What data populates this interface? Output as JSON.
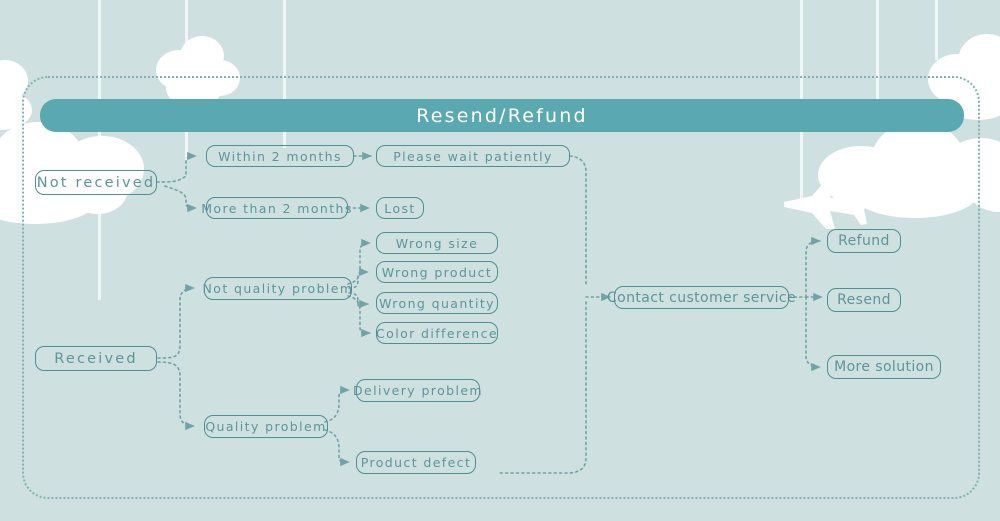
{
  "header": {
    "title": "Resend/Refund"
  },
  "colors": {
    "background": "#cfe0e0",
    "banner": "#5aa8b0",
    "node_border": "#4f8f92",
    "node_text": "#5c9599",
    "connector": "#6fa3a6",
    "frame": "#7fb3b3",
    "cloud": "#ffffff",
    "banner_text": "#ffffff"
  },
  "flow": {
    "roots": [
      {
        "id": "not-received",
        "label": "Not received"
      },
      {
        "id": "received",
        "label": "Received"
      }
    ],
    "not_received_branches": [
      {
        "id": "within-2-months",
        "label": "Within 2 months"
      },
      {
        "id": "more-than-2-months",
        "label": "More than 2 months"
      }
    ],
    "not_received_outcomes": [
      {
        "id": "please-wait-patiently",
        "label": "Please wait patiently"
      },
      {
        "id": "lost",
        "label": "Lost"
      }
    ],
    "received_branches": [
      {
        "id": "not-quality-problem",
        "label": "Not quality problem"
      },
      {
        "id": "quality-problem",
        "label": "Quality problem"
      }
    ],
    "not_quality_reasons": [
      {
        "id": "wrong-size",
        "label": "Wrong size"
      },
      {
        "id": "wrong-product",
        "label": "Wrong product"
      },
      {
        "id": "wrong-quantity",
        "label": "Wrong quantity"
      },
      {
        "id": "color-difference",
        "label": "Color difference"
      }
    ],
    "quality_reasons": [
      {
        "id": "delivery-problem",
        "label": "Delivery problem"
      },
      {
        "id": "product-defect",
        "label": "Product defect"
      }
    ],
    "hub": {
      "id": "contact-customer-service",
      "label": "Contact customer service"
    },
    "solutions": [
      {
        "id": "refund",
        "label": "Refund"
      },
      {
        "id": "resend",
        "label": "Resend"
      },
      {
        "id": "more-solution",
        "label": "More solution"
      }
    ]
  },
  "decor": {
    "plane_icon": "airplane-icon",
    "cloud_icon": "cloud-icon",
    "string_icon": "hanging-string-icon"
  }
}
